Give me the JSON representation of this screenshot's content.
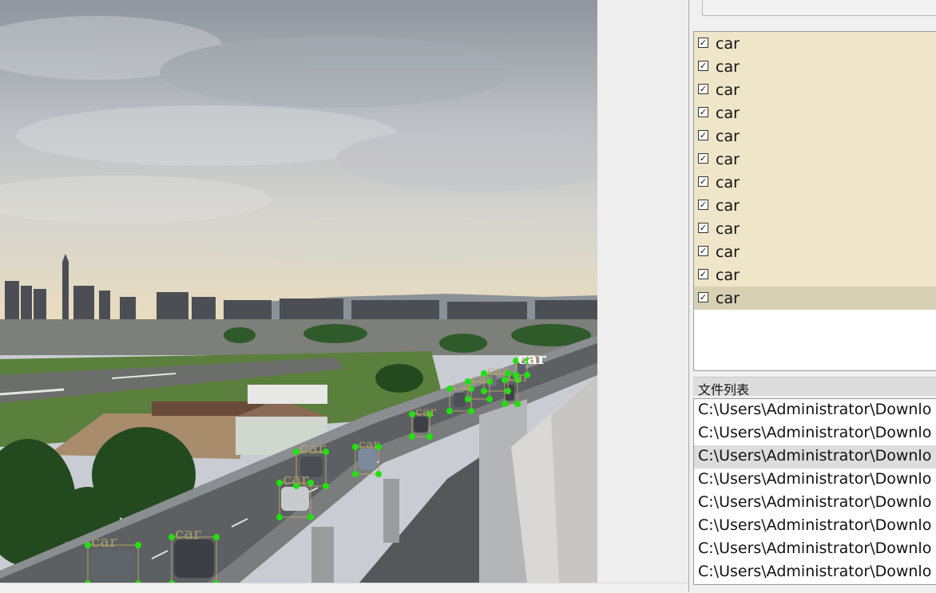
{
  "canvas": {
    "highlight_label": "car",
    "annotations": [
      {
        "label": "car"
      },
      {
        "label": "car"
      },
      {
        "label": "car"
      },
      {
        "label": "car"
      },
      {
        "label": "car"
      },
      {
        "label": "car"
      },
      {
        "label": "car"
      },
      {
        "label": "car"
      },
      {
        "label": "car"
      },
      {
        "label": "car"
      },
      {
        "label": "car"
      }
    ]
  },
  "label_list": {
    "items": [
      {
        "label": "car",
        "checked": true
      },
      {
        "label": "car",
        "checked": true
      },
      {
        "label": "car",
        "checked": true
      },
      {
        "label": "car",
        "checked": true
      },
      {
        "label": "car",
        "checked": true
      },
      {
        "label": "car",
        "checked": true
      },
      {
        "label": "car",
        "checked": true
      },
      {
        "label": "car",
        "checked": true
      },
      {
        "label": "car",
        "checked": true
      },
      {
        "label": "car",
        "checked": true
      },
      {
        "label": "car",
        "checked": true
      },
      {
        "label": "car",
        "checked": true
      }
    ]
  },
  "file_list": {
    "title": "文件列表",
    "items": [
      "C:\\Users\\Administrator\\Downlo",
      "C:\\Users\\Administrator\\Downlo",
      "C:\\Users\\Administrator\\Downlo",
      "C:\\Users\\Administrator\\Downlo",
      "C:\\Users\\Administrator\\Downlo",
      "C:\\Users\\Administrator\\Downlo",
      "C:\\Users\\Administrator\\Downlo",
      "C:\\Users\\Administrator\\Downlo"
    ]
  },
  "colors": {
    "label_bg": "#efe5c8",
    "label_selected_bg": "#d7d0b3",
    "vertex_green": "#22e010",
    "box_tan": "#b5a36a"
  }
}
